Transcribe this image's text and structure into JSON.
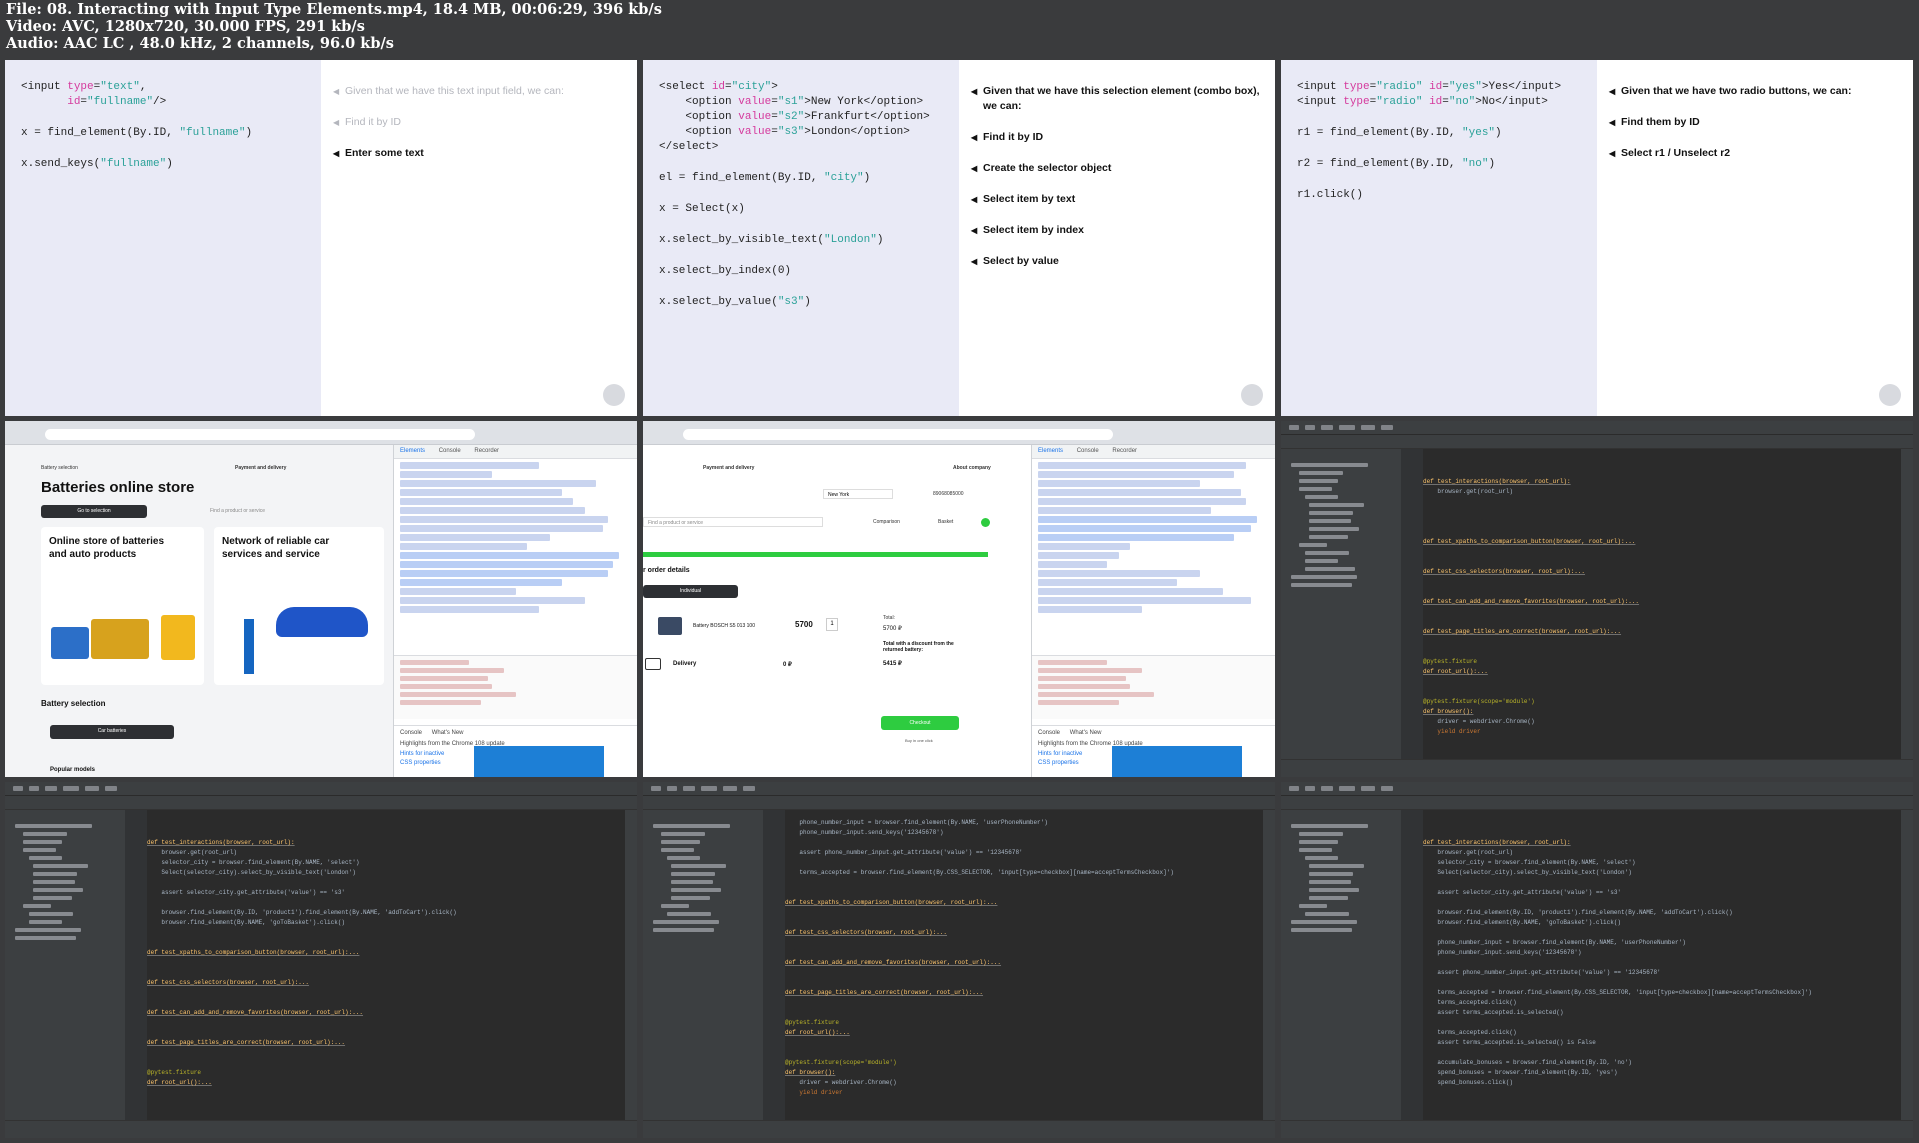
{
  "header": {
    "file_line": "File: 08. Interacting with Input Type Elements.mp4, 18.4 MB, 00:06:29, 396 kb/s",
    "video_line": "Video: AVC, 1280x720, 30.000 FPS, 291 kb/s",
    "audio_line": "Audio: AAC LC , 48.0 kHz, 2 channels, 96.0 kb/s"
  },
  "slide1": {
    "bullets": [
      "Given that we have this text input field, we can:",
      "Find it by ID",
      "Enter some text"
    ]
  },
  "slide2": {
    "bullets": [
      "Given that we have this selection element (combo box), we can:",
      "Find it by ID",
      "Create the selector object",
      "Select item by text",
      "Select item by index",
      "Select by value"
    ]
  },
  "slide3": {
    "bullets": [
      "Given that we have two radio buttons, we can:",
      "Find them by ID",
      "Select r1 / Unselect r2"
    ]
  },
  "browser1": {
    "nav_left": "Battery selection",
    "nav_right": "Payment and delivery",
    "title": "Batteries online store",
    "go_button": "Go to selection",
    "search_placeholder": "Find a product or service",
    "card1": "Online store of batteries and auto products",
    "card2": "Network of reliable car services and service",
    "section": "Battery selection",
    "car_button": "Car batteries",
    "popular": "Popular models",
    "devtools_tabs": [
      "Elements",
      "Console",
      "Recorder"
    ],
    "console_label": "Console",
    "whats_new": "What's New",
    "highlights": "Highlights from the Chrome 108 update",
    "hint1": "Hints for inactive",
    "hint2": "CSS properties"
  },
  "browser2": {
    "nav_left": "Payment and delivery",
    "nav_right": "About company",
    "city": "New York",
    "phone": "89068085000",
    "comparison": "Comparison",
    "basket": "Basket",
    "order_details": "r order details",
    "individual": "Individual",
    "product": "Battery BOSCH S5 013 100",
    "price": "5700",
    "qty": "1",
    "total_label": "Total:",
    "total": "5700 ₽",
    "discount_label": "Total with a discount from the returned battery:",
    "discount_total": "5415 ₽",
    "delivery": "Delivery",
    "delivery_price": "0 ₽",
    "checkout": "Checkout",
    "buy_one_click": "Buy in one click"
  },
  "ide": {
    "fn_interactions": "def test_interactions(browser, root_url):",
    "fn_xpaths": "def test_xpaths_to_comparison_button(browser, root_url):...",
    "fn_css": "def test_css_selectors(browser, root_url):...",
    "fn_favorites": "def test_can_add_and_remove_favorites(browser, root_url):...",
    "fn_titles": "def test_page_titles_are_correct(browser, root_url):...",
    "fixture": "@pytest.fixture",
    "fn_root": "def root_url():...",
    "fixture_module": "@pytest.fixture(scope='module')",
    "fn_browser": "def browser():",
    "line_get": "browser.get(root_url)",
    "line_select_city": "selector_city = browser.find_element(By.NAME, 'select')",
    "line_select_text": "Select(selector_city).select_by_visible_text('London')",
    "line_assert_city": "assert selector_city.get_attribute('value') == 's3'",
    "line_click_add": "browser.find_element(By.ID, 'product1').find_element(By.NAME, 'addToCart').click()",
    "line_click_basket": "browser.find_element(By.NAME, 'goToBasket').click()",
    "line_phone": "phone_number_input = browser.find_element(By.NAME, 'userPhoneNumber')",
    "line_send_keys": "phone_number_input.send_keys('12345678')",
    "line_assert_phone": "assert phone_number_input.get_attribute('value') == '12345678'",
    "line_terms": "terms_accepted = browser.find_element(By.CSS_SELECTOR, 'input[type=checkbox][name=acceptTermsCheckbox]')",
    "line_assert_terms": "assert terms_accepted.is_selected()",
    "line_terms_click": "terms_accepted.click()",
    "line_assert_not": "assert terms_accepted.is_selected() is False",
    "line_bonuses": "accumulate_bonuses = browser.find_element(By.ID, 'no')",
    "line_spend": "spend_bonuses = browser.find_element(By.ID, 'yes')",
    "line_spend_click": "spend_bonuses.click()",
    "line_driver": "driver = webdriver.Chrome()",
    "line_yield": "yield driver"
  }
}
